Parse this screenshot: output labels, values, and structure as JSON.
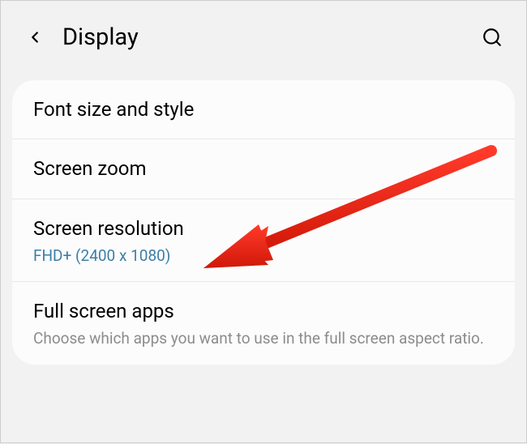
{
  "header": {
    "title": "Display"
  },
  "items": [
    {
      "title": "Font size and style"
    },
    {
      "title": "Screen zoom"
    },
    {
      "title": "Screen resolution",
      "sub": "FHD+ (2400 x 1080)"
    },
    {
      "title": "Full screen apps",
      "desc": "Choose which apps you want to use in the full screen aspect ratio."
    }
  ]
}
